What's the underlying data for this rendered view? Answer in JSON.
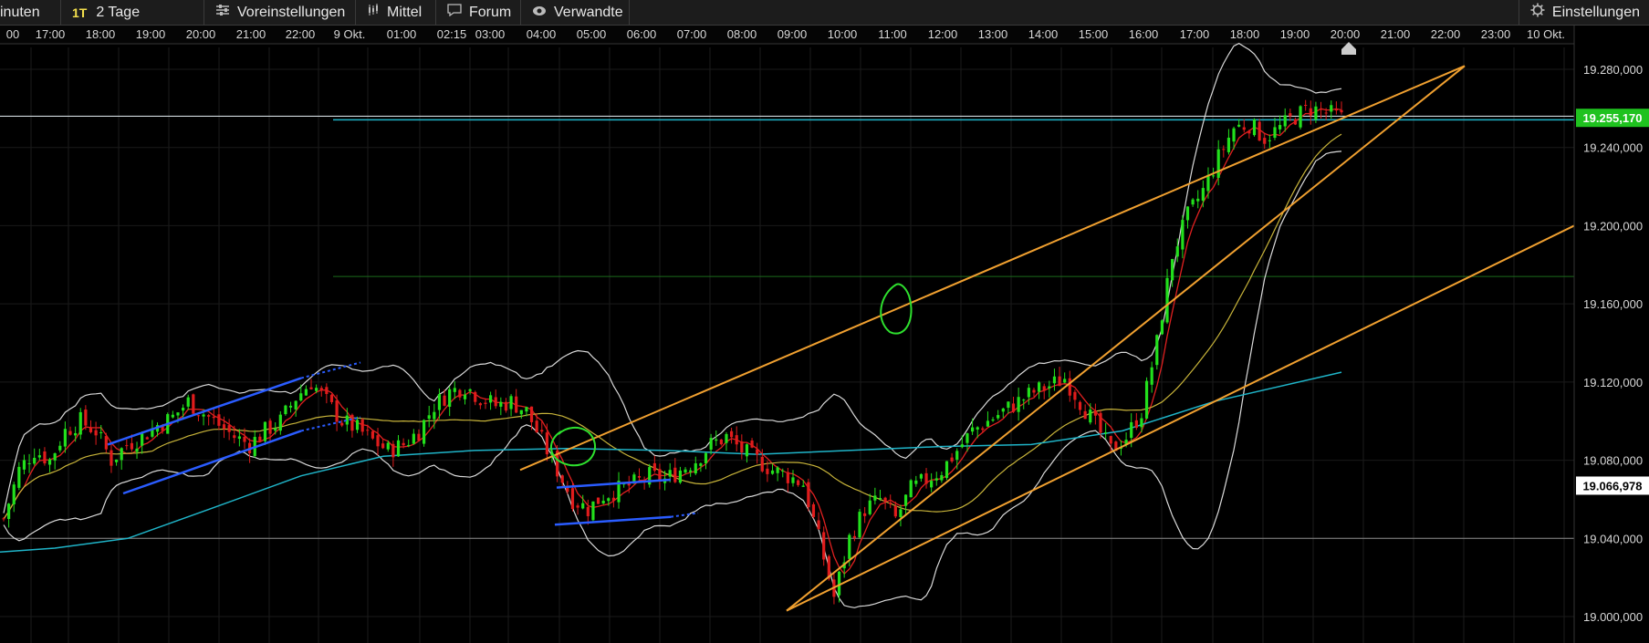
{
  "toolbar": {
    "interval_label": "inuten",
    "period_badge": "1T",
    "period_label": "2 Tage",
    "presets_label": "Voreinstellungen",
    "average_label": "Mittel",
    "forum_label": "Forum",
    "related_label": "Verwandte",
    "settings_label": "Einstellungen",
    "icons": {
      "presets": "sliders-icon",
      "average": "candlestick-icon",
      "forum": "speech-bubble-icon",
      "related": "eye-icon",
      "settings": "gear-icon"
    }
  },
  "colors": {
    "background": "#000000",
    "candle_up": "#22e01c",
    "candle_down": "#e01c1c",
    "bollinger": "#d9d9d9",
    "ma_short": "#e02020",
    "ma_mid": "#c8b43a",
    "ma_long": "#1fb4c8",
    "trend_orange": "#f0a030",
    "trend_blue": "#2a5cff",
    "current_price_bg": "#1fc21f",
    "last_marker_bg": "#ffffff"
  },
  "chart_data": {
    "type": "candlestick",
    "x_ticks": [
      "00",
      "17:00",
      "18:00",
      "19:00",
      "20:00",
      "21:00",
      "22:00",
      "9 Okt.",
      "01:00",
      "02:15",
      "03:00",
      "04:00",
      "05:00",
      "06:00",
      "07:00",
      "08:00",
      "09:00",
      "10:00",
      "11:00",
      "12:00",
      "13:00",
      "14:00",
      "15:00",
      "16:00",
      "17:00",
      "18:00",
      "19:00",
      "20:00",
      "21:00",
      "22:00",
      "23:00",
      "10 Okt."
    ],
    "y_ticks": [
      "19.280,000",
      "19.240,000",
      "19.200,000",
      "19.160,000",
      "19.120,000",
      "19.080,000",
      "19.040,000",
      "19.000,000"
    ],
    "ylim": [
      18995,
      19300
    ],
    "current_price_label": "19.255,170",
    "current_price": 19255.17,
    "last_marker_label": "19.066,978",
    "last_marker": 19066.978,
    "horizontal_levels": [
      19256,
      19174,
      19040
    ],
    "close_path": [
      [
        0,
        19050
      ],
      [
        3,
        19075
      ],
      [
        6,
        19085
      ],
      [
        9,
        19080
      ],
      [
        12,
        19095
      ],
      [
        15,
        19100
      ],
      [
        18,
        19095
      ],
      [
        21,
        19080
      ],
      [
        24,
        19088
      ],
      [
        27,
        19092
      ],
      [
        30,
        19098
      ],
      [
        33,
        19102
      ],
      [
        36,
        19110
      ],
      [
        39,
        19104
      ],
      [
        42,
        19098
      ],
      [
        45,
        19092
      ],
      [
        48,
        19088
      ],
      [
        51,
        19095
      ],
      [
        54,
        19100
      ],
      [
        57,
        19112
      ],
      [
        60,
        19120
      ],
      [
        63,
        19110
      ],
      [
        66,
        19100
      ],
      [
        69,
        19096
      ],
      [
        72,
        19090
      ],
      [
        75,
        19085
      ],
      [
        78,
        19088
      ],
      [
        81,
        19095
      ],
      [
        84,
        19108
      ],
      [
        87,
        19115
      ],
      [
        90,
        19118
      ],
      [
        93,
        19112
      ],
      [
        96,
        19108
      ],
      [
        99,
        19110
      ],
      [
        102,
        19105
      ],
      [
        105,
        19090
      ],
      [
        108,
        19075
      ],
      [
        111,
        19060
      ],
      [
        114,
        19055
      ],
      [
        117,
        19062
      ],
      [
        120,
        19065
      ],
      [
        123,
        19068
      ],
      [
        126,
        19072
      ],
      [
        129,
        19070
      ],
      [
        132,
        19075
      ],
      [
        135,
        19080
      ],
      [
        138,
        19088
      ],
      [
        141,
        19092
      ],
      [
        144,
        19085
      ],
      [
        147,
        19080
      ],
      [
        150,
        19075
      ],
      [
        153,
        19072
      ],
      [
        156,
        19068
      ],
      [
        159,
        19040
      ],
      [
        162,
        19010
      ],
      [
        165,
        19040
      ],
      [
        168,
        19055
      ],
      [
        171,
        19060
      ],
      [
        174,
        19050
      ],
      [
        177,
        19065
      ],
      [
        180,
        19070
      ],
      [
        183,
        19075
      ],
      [
        186,
        19085
      ],
      [
        189,
        19095
      ],
      [
        192,
        19100
      ],
      [
        195,
        19105
      ],
      [
        198,
        19110
      ],
      [
        201,
        19115
      ],
      [
        204,
        19118
      ],
      [
        207,
        19122
      ],
      [
        210,
        19110
      ],
      [
        213,
        19098
      ],
      [
        216,
        19085
      ],
      [
        219,
        19092
      ],
      [
        222,
        19105
      ],
      [
        225,
        19140
      ],
      [
        228,
        19185
      ],
      [
        231,
        19205
      ],
      [
        234,
        19218
      ],
      [
        237,
        19235
      ],
      [
        240,
        19250
      ],
      [
        243,
        19252
      ],
      [
        246,
        19245
      ],
      [
        249,
        19250
      ],
      [
        252,
        19256
      ],
      [
        255,
        19260
      ],
      [
        258,
        19258
      ],
      [
        261,
        19255
      ]
    ]
  }
}
